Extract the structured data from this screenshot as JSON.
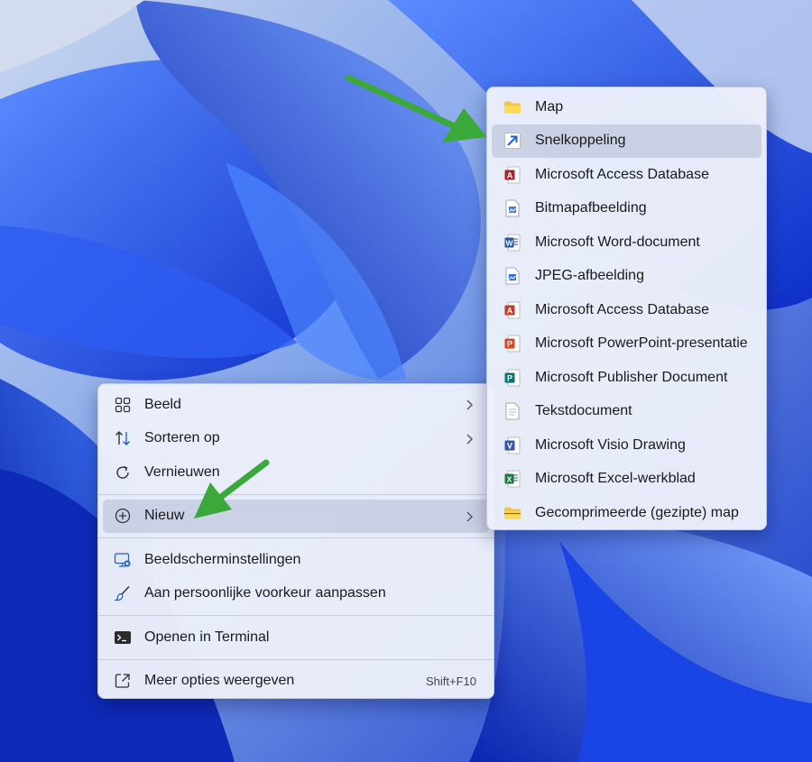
{
  "context_menu": {
    "items": [
      {
        "label": "Beeld",
        "icon": "grid-view-icon"
      },
      {
        "label": "Sorteren op",
        "icon": "sort-arrows-icon"
      },
      {
        "label": "Vernieuwen",
        "icon": "refresh-icon"
      },
      {
        "label": "Nieuw",
        "icon": "plus-circle-icon"
      },
      {
        "label": "Beeldscherminstellingen",
        "icon": "display-settings-icon"
      },
      {
        "label": "Aan persoonlijke voorkeur aanpassen",
        "icon": "paintbrush-icon"
      },
      {
        "label": "Openen in Terminal",
        "icon": "terminal-icon"
      },
      {
        "label": "Meer opties weergeven",
        "icon": "external-link-icon",
        "shortcut": "Shift+F10"
      }
    ]
  },
  "submenu": {
    "items": [
      {
        "label": "Map",
        "icon": "folder-icon"
      },
      {
        "label": "Snelkoppeling",
        "icon": "shortcut-arrow-icon"
      },
      {
        "label": "Microsoft Access Database",
        "icon": "access-icon"
      },
      {
        "label": "Bitmapafbeelding",
        "icon": "bitmap-file-icon"
      },
      {
        "label": "Microsoft Word-document",
        "icon": "word-icon"
      },
      {
        "label": "JPEG-afbeelding",
        "icon": "jpeg-file-icon"
      },
      {
        "label": "Microsoft Access Database",
        "icon": "access-icon"
      },
      {
        "label": "Microsoft PowerPoint-presentatie",
        "icon": "powerpoint-icon"
      },
      {
        "label": "Microsoft Publisher Document",
        "icon": "publisher-icon"
      },
      {
        "label": "Tekstdocument",
        "icon": "text-file-icon"
      },
      {
        "label": "Microsoft Visio Drawing",
        "icon": "visio-icon"
      },
      {
        "label": "Microsoft Excel-werkblad",
        "icon": "excel-icon"
      },
      {
        "label": "Gecomprimeerde (gezipte) map",
        "icon": "zip-folder-icon"
      }
    ]
  },
  "colors": {
    "annotation_arrow": "#3aa83a",
    "wallpaper_blue": "#1c3fd8"
  }
}
